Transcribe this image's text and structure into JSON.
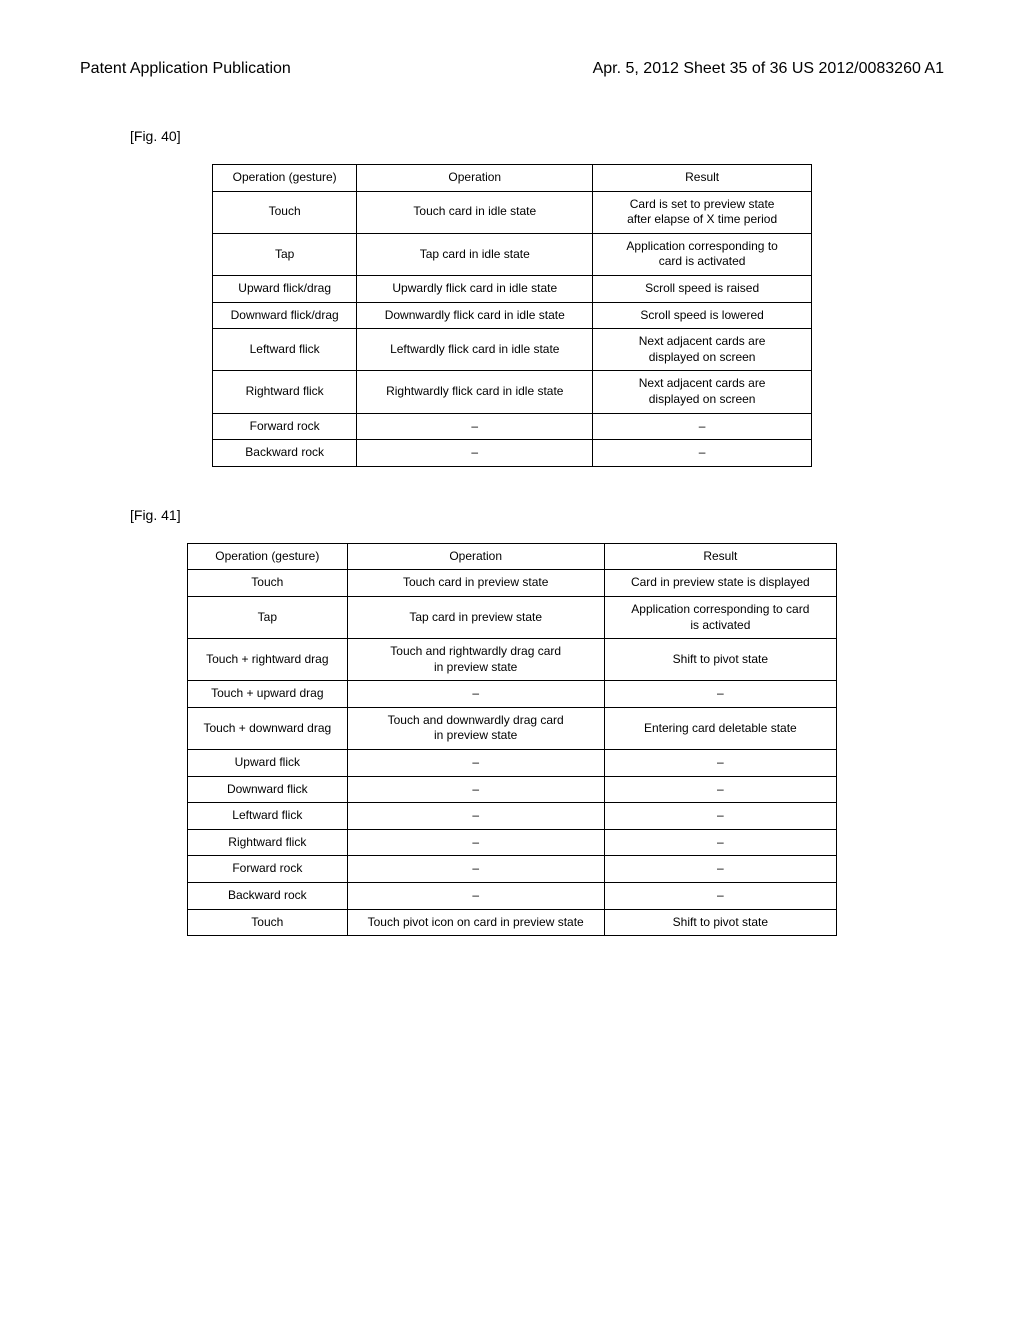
{
  "header": {
    "left": "Patent Application Publication",
    "right": "Apr. 5, 2012   Sheet 35 of 36     US 2012/0083260 A1"
  },
  "fig40": {
    "label": "[Fig. 40]",
    "headers": [
      "Operation (gesture)",
      "Operation",
      "Result"
    ],
    "rows": [
      [
        "Touch",
        "Touch card in idle state",
        "Card is set to preview state\nafter elapse of X time period"
      ],
      [
        "Tap",
        "Tap card in idle state",
        "Application corresponding to\ncard is activated"
      ],
      [
        "Upward flick/drag",
        "Upwardly flick card in idle state",
        "Scroll speed is raised"
      ],
      [
        "Downward flick/drag",
        "Downwardly flick card in idle state",
        "Scroll speed is lowered"
      ],
      [
        "Leftward flick",
        "Leftwardly flick card in idle state",
        "Next adjacent cards are\ndisplayed on screen"
      ],
      [
        "Rightward flick",
        "Rightwardly flick card in idle state",
        "Next adjacent cards are\ndisplayed on screen"
      ],
      [
        "Forward rock",
        "–",
        "–"
      ],
      [
        "Backward rock",
        "–",
        "–"
      ]
    ]
  },
  "fig41": {
    "label": "[Fig. 41]",
    "headers": [
      "Operation (gesture)",
      "Operation",
      "Result"
    ],
    "rows": [
      [
        "Touch",
        "Touch card in preview state",
        "Card in preview state is displayed"
      ],
      [
        "Tap",
        "Tap card in preview state",
        "Application corresponding to card\nis activated"
      ],
      [
        "Touch + rightward drag",
        "Touch and rightwardly drag card\nin preview state",
        "Shift to pivot state"
      ],
      [
        "Touch + upward drag",
        "–",
        "–"
      ],
      [
        "Touch + downward drag",
        "Touch and downwardly drag card\nin preview state",
        "Entering card deletable state"
      ],
      [
        "Upward flick",
        "–",
        "–"
      ],
      [
        "Downward flick",
        "–",
        "–"
      ],
      [
        "Leftward flick",
        "–",
        "–"
      ],
      [
        "Rightward flick",
        "–",
        "–"
      ],
      [
        "Forward rock",
        "–",
        "–"
      ],
      [
        "Backward rock",
        "–",
        "–"
      ],
      [
        "Touch",
        "Touch pivot icon on card in preview state",
        "Shift to pivot state"
      ]
    ]
  }
}
